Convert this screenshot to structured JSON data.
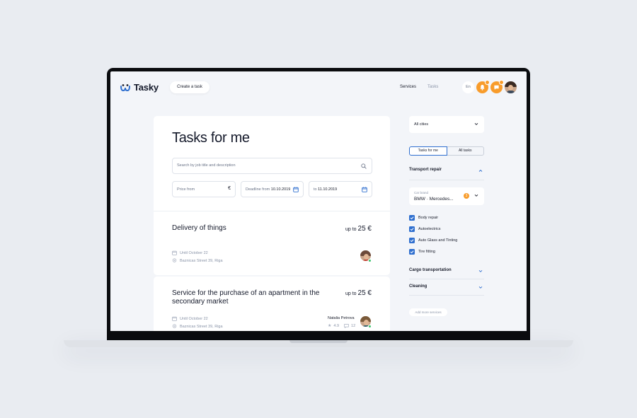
{
  "header": {
    "logo_text": "Tasky",
    "create_task_label": "Create a task",
    "nav_services": "Services",
    "nav_tasks": "Tasks",
    "lang": "En"
  },
  "main": {
    "title": "Tasks for me",
    "search_placeholder": "Search by job title and description",
    "price_from_label": "Price from",
    "currency_symbol": "€",
    "deadline_from_label": "Deadline from",
    "deadline_from_value": "10.10.2019",
    "deadline_to_label": "to",
    "deadline_to_value": "11.10.2019"
  },
  "tasks": [
    {
      "title": "Delivery of things",
      "price_prefix": "up to",
      "price_amount": "25 €",
      "deadline": "Until October 22",
      "address": "Baznicas Street 39, Riga"
    },
    {
      "title": "Service for the purchase of an apartment in the secondary market",
      "price_prefix": "up to",
      "price_amount": "25 €",
      "deadline": "Until October 22",
      "address": "Baznicas Street 39, Riga",
      "person_name": "Natalia Petrova",
      "rating": "4.9",
      "reviews": "12"
    }
  ],
  "sidebar": {
    "city_select": "All cities",
    "seg_tasks_for_me": "Tasks for me",
    "seg_all_tasks": "All tasks",
    "section_transport": "Transport repair",
    "car_brand_caption": "Car brand",
    "car_brand_value": "BMW · Mercedes...",
    "car_brand_count": "3",
    "checkboxes": [
      "Body repair",
      "Autoelectrics",
      "Auto Glass and Tinting",
      "Tire fitting"
    ],
    "section_cargo": "Cargo transportation",
    "section_cleaning": "Cleaning",
    "add_more": "Add more services"
  },
  "colors": {
    "accent": "#2f6fcf",
    "orange": "#f89c2b",
    "background": "#f3f5f9"
  }
}
